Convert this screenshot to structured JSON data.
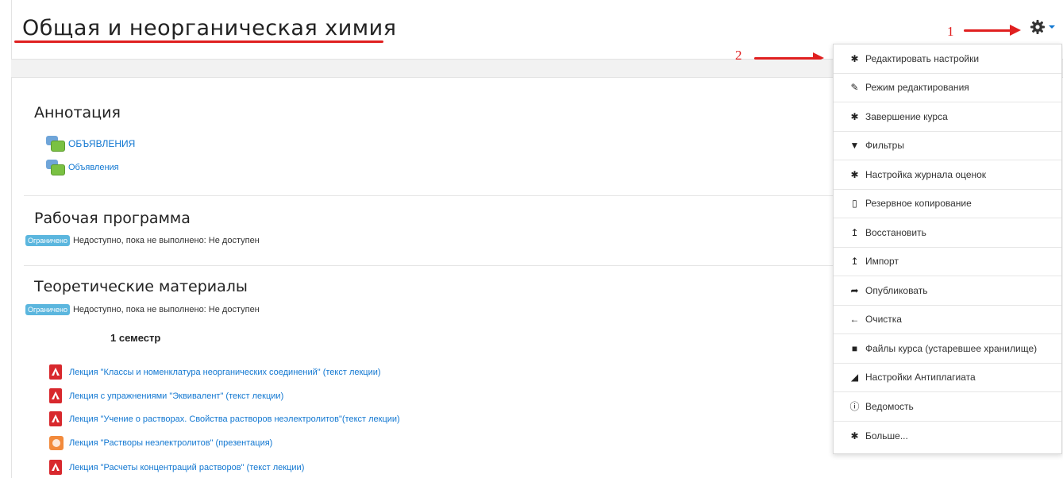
{
  "header": {
    "course_title": "Общая и неорганическая химия"
  },
  "annotations": {
    "marker1": "1",
    "marker2": "2",
    "accent_color": "#e02020"
  },
  "sections": [
    {
      "title": "Аннотация",
      "activities": [
        {
          "label": "ОБЪЯВЛЕНИЯ",
          "icon": "forum-icon"
        },
        {
          "label": "Объявления",
          "icon": "forum-icon"
        }
      ]
    },
    {
      "title": "Рабочая программа",
      "restriction": {
        "badge": "Ограничено",
        "text": "Недоступно, пока не выполнено: Не доступен"
      }
    },
    {
      "title": "Теоретические материалы",
      "restriction": {
        "badge": "Ограничено",
        "text": "Недоступно, пока не выполнено: Не доступен"
      },
      "subheading": "1 семестр",
      "activities": [
        {
          "label": "Лекция \"Классы и номенклатура неорганических соединений\" (текст лекции)",
          "icon": "pdf-icon"
        },
        {
          "label": "Лекция с упражнениями \"Эквивалент\" (текст лекции)",
          "icon": "pdf-icon"
        },
        {
          "label": "Лекция \"Учение о растворах. Свойства растворов неэлектролитов\"(текст лекции)",
          "icon": "pdf-icon"
        },
        {
          "label": "Лекция \"Растворы неэлектролитов\" (презентация)",
          "icon": "presentation-icon"
        },
        {
          "label": "Лекция \"Расчеты концентраций растворов\" (текст лекции)",
          "icon": "pdf-icon"
        }
      ]
    }
  ],
  "menu": {
    "items": [
      {
        "label": "Редактировать настройки",
        "icon": "gear-icon"
      },
      {
        "label": "Режим редактирования",
        "icon": "pencil-icon"
      },
      {
        "label": "Завершение курса",
        "icon": "gear-icon"
      },
      {
        "label": "Фильтры",
        "icon": "filter-icon"
      },
      {
        "label": "Настройка журнала оценок",
        "icon": "gear-icon"
      },
      {
        "label": "Резервное копирование",
        "icon": "file-archive-icon"
      },
      {
        "label": "Восстановить",
        "icon": "upload-icon"
      },
      {
        "label": "Импорт",
        "icon": "upload-icon"
      },
      {
        "label": "Опубликовать",
        "icon": "share-icon"
      },
      {
        "label": "Очистка",
        "icon": "arrow-left-icon"
      },
      {
        "label": "Файлы курса (устаревшее хранилище)",
        "icon": "folder-icon"
      },
      {
        "label": "Настройки Антиплагиата",
        "icon": "area-chart-icon"
      },
      {
        "label": "Ведомость",
        "icon": "info-icon"
      },
      {
        "label": "Больше...",
        "icon": "gear-icon"
      }
    ]
  }
}
